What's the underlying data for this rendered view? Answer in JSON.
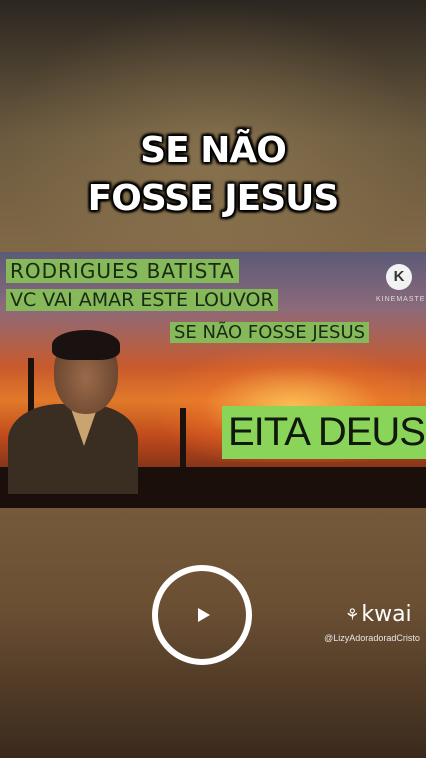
{
  "headline": {
    "line1": "SE NÃO",
    "line2": "FOSSE JESUS"
  },
  "thumbnail": {
    "artist": "RODRIGUES BATISTA",
    "subtitle": "VC VAI AMAR ESTE LOUVOR",
    "song": "SE NÃO FOSSE JESUS",
    "exclaim": "EITA DEUS",
    "watermark_letter": "K",
    "watermark_text": "KINEMASTER"
  },
  "player": {
    "play_icon": "play-icon"
  },
  "brand": {
    "name": "kwai",
    "icon": "kwai-logo-icon",
    "handle": "@LizyAdoradoradCristo"
  }
}
